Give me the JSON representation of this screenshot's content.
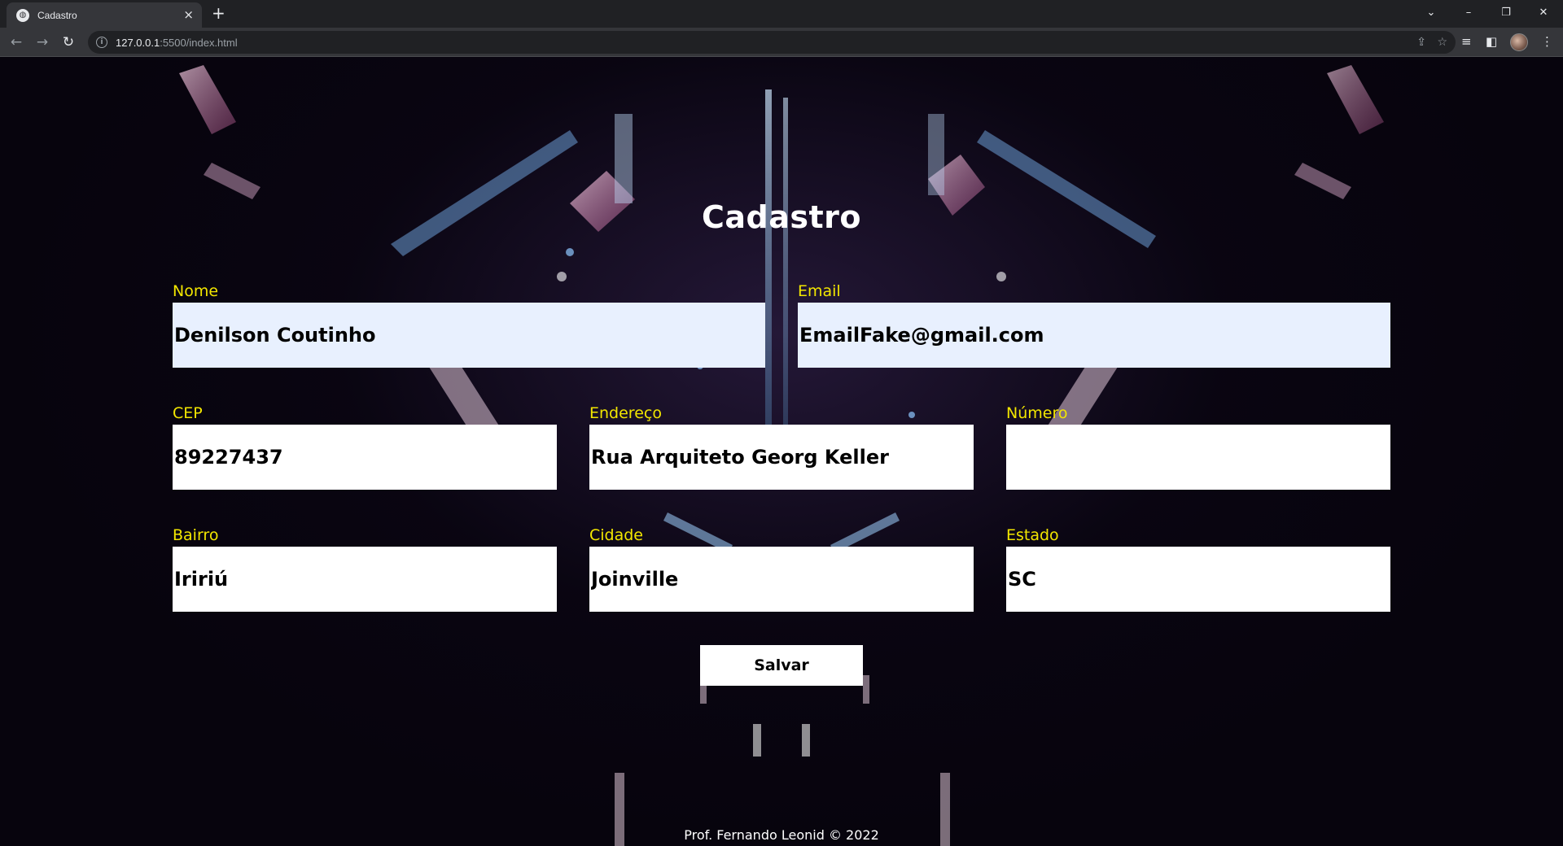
{
  "browser": {
    "tab_title": "Cadastro",
    "tab_favicon": "globe-icon",
    "url_host": "127.0.0.1",
    "url_rest": ":5500/index.html"
  },
  "form": {
    "title": "Cadastro",
    "fields": {
      "nome": {
        "label": "Nome",
        "value": "Denilson Coutinho"
      },
      "email": {
        "label": "Email",
        "value": "EmailFake@gmail.com"
      },
      "cep": {
        "label": "CEP",
        "value": "89227437"
      },
      "endereco": {
        "label": "Endereço",
        "value": "Rua Arquiteto Georg Keller"
      },
      "numero": {
        "label": "Número",
        "value": ""
      },
      "bairro": {
        "label": "Bairro",
        "value": "Iririú"
      },
      "cidade": {
        "label": "Cidade",
        "value": "Joinville"
      },
      "estado": {
        "label": "Estado",
        "value": "SC"
      }
    },
    "submit_label": "Salvar"
  },
  "footer": {
    "text": "Prof. Fernando Leonid © 2022"
  },
  "colors": {
    "label": "#f2e600",
    "autofill_bg": "#e8f0fe",
    "page_bg": "#07040d"
  }
}
